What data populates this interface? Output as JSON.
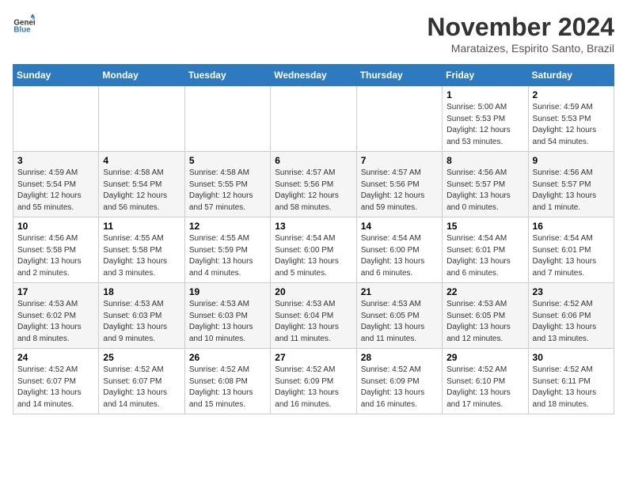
{
  "logo": {
    "general": "General",
    "blue": "Blue"
  },
  "header": {
    "month_title": "November 2024",
    "subtitle": "Marataizes, Espirito Santo, Brazil"
  },
  "days_of_week": [
    "Sunday",
    "Monday",
    "Tuesday",
    "Wednesday",
    "Thursday",
    "Friday",
    "Saturday"
  ],
  "weeks": [
    [
      {
        "day": "",
        "info": ""
      },
      {
        "day": "",
        "info": ""
      },
      {
        "day": "",
        "info": ""
      },
      {
        "day": "",
        "info": ""
      },
      {
        "day": "",
        "info": ""
      },
      {
        "day": "1",
        "info": "Sunrise: 5:00 AM\nSunset: 5:53 PM\nDaylight: 12 hours and 53 minutes."
      },
      {
        "day": "2",
        "info": "Sunrise: 4:59 AM\nSunset: 5:53 PM\nDaylight: 12 hours and 54 minutes."
      }
    ],
    [
      {
        "day": "3",
        "info": "Sunrise: 4:59 AM\nSunset: 5:54 PM\nDaylight: 12 hours and 55 minutes."
      },
      {
        "day": "4",
        "info": "Sunrise: 4:58 AM\nSunset: 5:54 PM\nDaylight: 12 hours and 56 minutes."
      },
      {
        "day": "5",
        "info": "Sunrise: 4:58 AM\nSunset: 5:55 PM\nDaylight: 12 hours and 57 minutes."
      },
      {
        "day": "6",
        "info": "Sunrise: 4:57 AM\nSunset: 5:56 PM\nDaylight: 12 hours and 58 minutes."
      },
      {
        "day": "7",
        "info": "Sunrise: 4:57 AM\nSunset: 5:56 PM\nDaylight: 12 hours and 59 minutes."
      },
      {
        "day": "8",
        "info": "Sunrise: 4:56 AM\nSunset: 5:57 PM\nDaylight: 13 hours and 0 minutes."
      },
      {
        "day": "9",
        "info": "Sunrise: 4:56 AM\nSunset: 5:57 PM\nDaylight: 13 hours and 1 minute."
      }
    ],
    [
      {
        "day": "10",
        "info": "Sunrise: 4:56 AM\nSunset: 5:58 PM\nDaylight: 13 hours and 2 minutes."
      },
      {
        "day": "11",
        "info": "Sunrise: 4:55 AM\nSunset: 5:58 PM\nDaylight: 13 hours and 3 minutes."
      },
      {
        "day": "12",
        "info": "Sunrise: 4:55 AM\nSunset: 5:59 PM\nDaylight: 13 hours and 4 minutes."
      },
      {
        "day": "13",
        "info": "Sunrise: 4:54 AM\nSunset: 6:00 PM\nDaylight: 13 hours and 5 minutes."
      },
      {
        "day": "14",
        "info": "Sunrise: 4:54 AM\nSunset: 6:00 PM\nDaylight: 13 hours and 6 minutes."
      },
      {
        "day": "15",
        "info": "Sunrise: 4:54 AM\nSunset: 6:01 PM\nDaylight: 13 hours and 6 minutes."
      },
      {
        "day": "16",
        "info": "Sunrise: 4:54 AM\nSunset: 6:01 PM\nDaylight: 13 hours and 7 minutes."
      }
    ],
    [
      {
        "day": "17",
        "info": "Sunrise: 4:53 AM\nSunset: 6:02 PM\nDaylight: 13 hours and 8 minutes."
      },
      {
        "day": "18",
        "info": "Sunrise: 4:53 AM\nSunset: 6:03 PM\nDaylight: 13 hours and 9 minutes."
      },
      {
        "day": "19",
        "info": "Sunrise: 4:53 AM\nSunset: 6:03 PM\nDaylight: 13 hours and 10 minutes."
      },
      {
        "day": "20",
        "info": "Sunrise: 4:53 AM\nSunset: 6:04 PM\nDaylight: 13 hours and 11 minutes."
      },
      {
        "day": "21",
        "info": "Sunrise: 4:53 AM\nSunset: 6:05 PM\nDaylight: 13 hours and 11 minutes."
      },
      {
        "day": "22",
        "info": "Sunrise: 4:53 AM\nSunset: 6:05 PM\nDaylight: 13 hours and 12 minutes."
      },
      {
        "day": "23",
        "info": "Sunrise: 4:52 AM\nSunset: 6:06 PM\nDaylight: 13 hours and 13 minutes."
      }
    ],
    [
      {
        "day": "24",
        "info": "Sunrise: 4:52 AM\nSunset: 6:07 PM\nDaylight: 13 hours and 14 minutes."
      },
      {
        "day": "25",
        "info": "Sunrise: 4:52 AM\nSunset: 6:07 PM\nDaylight: 13 hours and 14 minutes."
      },
      {
        "day": "26",
        "info": "Sunrise: 4:52 AM\nSunset: 6:08 PM\nDaylight: 13 hours and 15 minutes."
      },
      {
        "day": "27",
        "info": "Sunrise: 4:52 AM\nSunset: 6:09 PM\nDaylight: 13 hours and 16 minutes."
      },
      {
        "day": "28",
        "info": "Sunrise: 4:52 AM\nSunset: 6:09 PM\nDaylight: 13 hours and 16 minutes."
      },
      {
        "day": "29",
        "info": "Sunrise: 4:52 AM\nSunset: 6:10 PM\nDaylight: 13 hours and 17 minutes."
      },
      {
        "day": "30",
        "info": "Sunrise: 4:52 AM\nSunset: 6:11 PM\nDaylight: 13 hours and 18 minutes."
      }
    ]
  ]
}
